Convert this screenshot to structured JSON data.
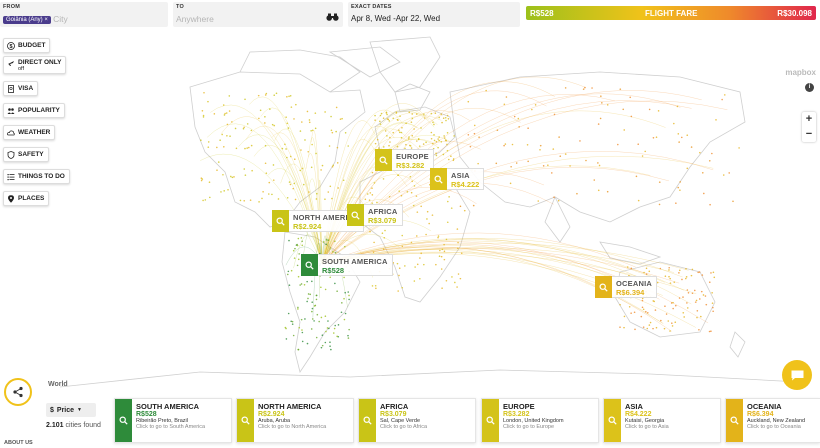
{
  "search": {
    "from_label": "FROM",
    "from_chip": "Goiânia (Any)",
    "chip_close": "×",
    "from_placeholder": "City",
    "to_label": "TO",
    "to_placeholder": "Anywhere",
    "dates_label": "EXACT DATES",
    "dates_value": "Apr 8, Wed -Apr 22, Wed"
  },
  "fare_legend": {
    "min": "R$528",
    "title": "FLIGHT FARE",
    "max": "R$30.098"
  },
  "map": {
    "attribution": "mapbox",
    "info": "i",
    "zoom_in": "+",
    "zoom_out": "−"
  },
  "filters": [
    {
      "label": "BUDGET",
      "icon": "dollar-icon"
    },
    {
      "label": "DIRECT ONLY",
      "sub": "off",
      "icon": "plane-icon"
    },
    {
      "label": "VISA",
      "icon": "passport-icon"
    },
    {
      "label": "POPULARITY",
      "icon": "people-icon"
    },
    {
      "label": "WEATHER",
      "icon": "cloud-icon"
    },
    {
      "label": "SAFETY",
      "icon": "shield-icon"
    },
    {
      "label": "THINGS TO DO",
      "icon": "list-icon"
    },
    {
      "label": "PLACES",
      "icon": "pin-icon"
    }
  ],
  "markers": [
    {
      "name": "EUROPE",
      "price": "R$3.282",
      "color": "#d4c31a"
    },
    {
      "name": "ASIA",
      "price": "R$4.222",
      "color": "#dcc21a"
    },
    {
      "name": "NORTH AMERICA",
      "price": "R$2.924",
      "color": "#c9c417"
    },
    {
      "name": "AFRICA",
      "price": "R$3.079",
      "color": "#c9c417"
    },
    {
      "name": "SOUTH AMERICA",
      "price": "R$528",
      "color": "#2e8b3a"
    },
    {
      "name": "OCEANIA",
      "price": "R$6.394",
      "color": "#e3b31a"
    }
  ],
  "bottom": {
    "world": "World",
    "price_currency": "$",
    "price_label": "Price",
    "count_num": "2.101",
    "count_text": " cities found",
    "about": "ABOUT US"
  },
  "cards": [
    {
      "name": "SOUTH AMERICA",
      "price": "R$528",
      "city": "Ribeirão Preto, Brazil",
      "link": "Click to go to South America",
      "color": "#2e8b3a"
    },
    {
      "name": "NORTH AMERICA",
      "price": "R$2.924",
      "city": "Aruba, Aruba",
      "link": "Click to go to North America",
      "color": "#c9c417"
    },
    {
      "name": "AFRICA",
      "price": "R$3.079",
      "city": "Sal, Cape Verde",
      "link": "Click to go to Africa",
      "color": "#c9c417"
    },
    {
      "name": "EUROPE",
      "price": "R$3.282",
      "city": "London, United Kingdom",
      "link": "Click to go to Europe",
      "color": "#d4c31a"
    },
    {
      "name": "ASIA",
      "price": "R$4.222",
      "city": "Kutaisi, Georgia",
      "link": "Click to go to Asia",
      "color": "#dcc21a"
    },
    {
      "name": "OCEANIA",
      "price": "R$6.394",
      "city": "Auckland, New Zealand",
      "link": "Click to go to Oceania",
      "color": "#e3b31a"
    }
  ]
}
